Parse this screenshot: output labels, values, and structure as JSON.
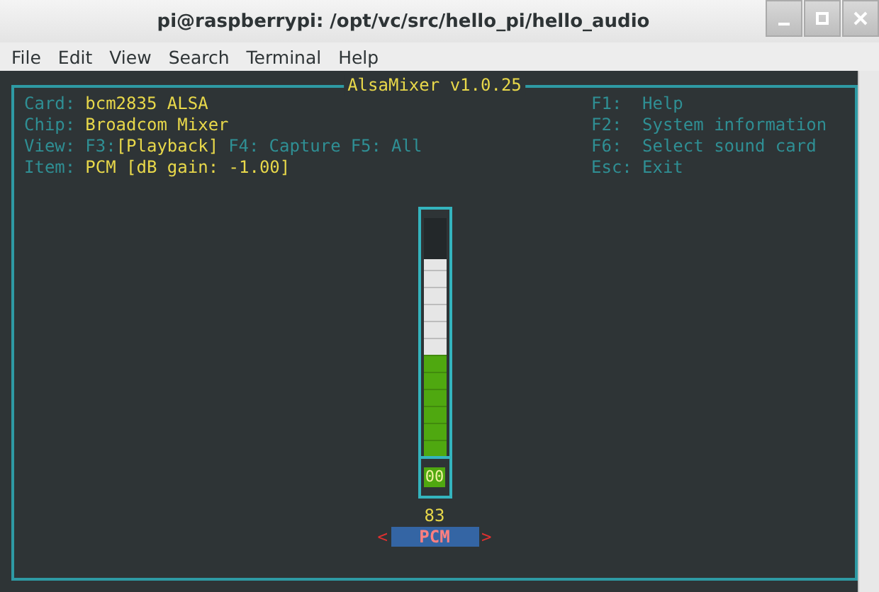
{
  "window": {
    "title": "pi@raspberrypi: /opt/vc/src/hello_pi/hello_audio"
  },
  "menu": [
    "File",
    "Edit",
    "View",
    "Search",
    "Terminal",
    "Help"
  ],
  "mixer": {
    "title": "AlsaMixer v1.0.25",
    "info": [
      {
        "label": "Card:",
        "value": "bcm2835 ALSA"
      },
      {
        "label": "Chip:",
        "value": "Broadcom Mixer"
      }
    ],
    "view_label": "View:",
    "views": [
      {
        "key": "F3:",
        "label": "[Playback]",
        "selected": true
      },
      {
        "key": "F4:",
        "label": "Capture",
        "selected": false
      },
      {
        "key": "F5:",
        "label": "All",
        "selected": false
      }
    ],
    "item": {
      "label": "Item:",
      "value": "PCM [dB gain: -1.00]"
    },
    "help": [
      {
        "key": "F1:",
        "text": "Help"
      },
      {
        "key": "F2:",
        "text": "System information"
      },
      {
        "key": "F6:",
        "text": "Select sound card"
      },
      {
        "key": "Esc:",
        "text": "Exit"
      }
    ],
    "controls": [
      {
        "name": "PCM",
        "level": 0.83,
        "value": "83",
        "mute": "00",
        "muted": false,
        "selected": true,
        "left": "<",
        "right": ">"
      }
    ]
  }
}
